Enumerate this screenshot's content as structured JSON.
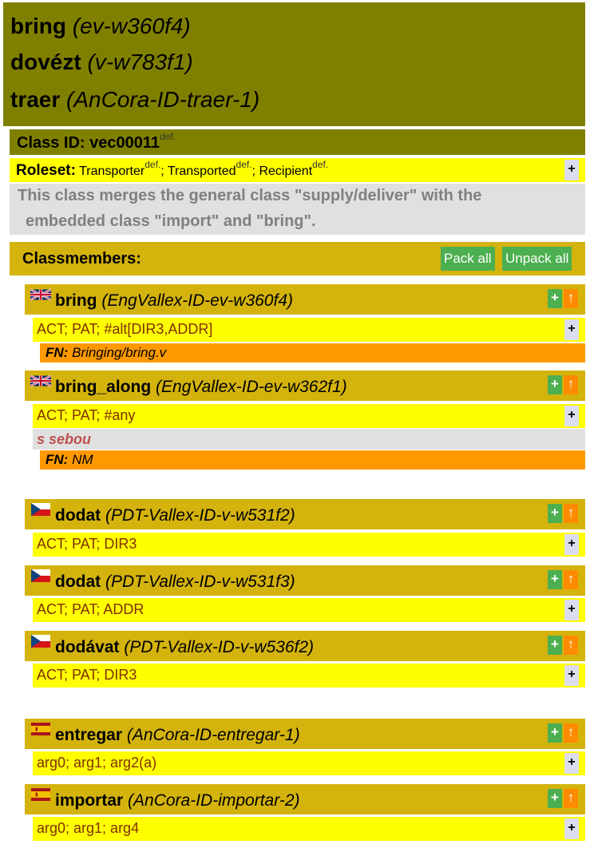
{
  "header": {
    "lines": [
      {
        "word": "bring",
        "id": "(ev-w360f4)"
      },
      {
        "word": "dovézt",
        "id": "(v-w783f1)"
      },
      {
        "word": "traer",
        "id": "(AnCora-ID-traer-1)"
      }
    ]
  },
  "class": {
    "label": "Class ID: vec00011",
    "def": "def."
  },
  "roleset": {
    "label": "Roleset:",
    "roles": [
      "Transporter",
      "Transported",
      "Recipient"
    ],
    "def": "def.",
    "sep": "; "
  },
  "description": {
    "line1": "This class merges the general class \"supply/deliver\" with the",
    "line2": "embedded class \"import\" and \"bring\"."
  },
  "classmembers": {
    "label": "Classmembers:",
    "pack_all": "Pack all",
    "unpack_all": "Unpack all"
  },
  "controls": {
    "plus": "+",
    "up": "↑"
  },
  "members": [
    {
      "flag": "uk",
      "word": "bring",
      "id": "(EngVallex-ID-ev-w360f4)",
      "frame": "ACT; PAT; #alt[DIR3,ADDR]",
      "fn_label": "FN:",
      "fn_value": "Bringing/bring.v"
    },
    {
      "flag": "uk",
      "word": "bring_along",
      "id": "(EngVallex-ID-ev-w362f1)",
      "frame": "ACT; PAT; #any",
      "gloss": "s sebou",
      "fn_label": "FN:",
      "fn_value": "NM"
    },
    {
      "flag": "cz",
      "word": "dodat",
      "id": "(PDT-Vallex-ID-v-w531f2)",
      "frame": "ACT; PAT; DIR3"
    },
    {
      "flag": "cz",
      "word": "dodat",
      "id": "(PDT-Vallex-ID-v-w531f3)",
      "frame": "ACT; PAT; ADDR"
    },
    {
      "flag": "cz",
      "word": "dodávat",
      "id": "(PDT-Vallex-ID-v-w536f2)",
      "frame": "ACT; PAT; DIR3"
    },
    {
      "flag": "es",
      "word": "entregar",
      "id": "(AnCora-ID-entregar-1)",
      "frame": "arg0; arg1; arg2(a)"
    },
    {
      "flag": "es",
      "word": "importar",
      "id": "(AnCora-ID-importar-2)",
      "frame": "arg0; arg1; arg4"
    }
  ]
}
